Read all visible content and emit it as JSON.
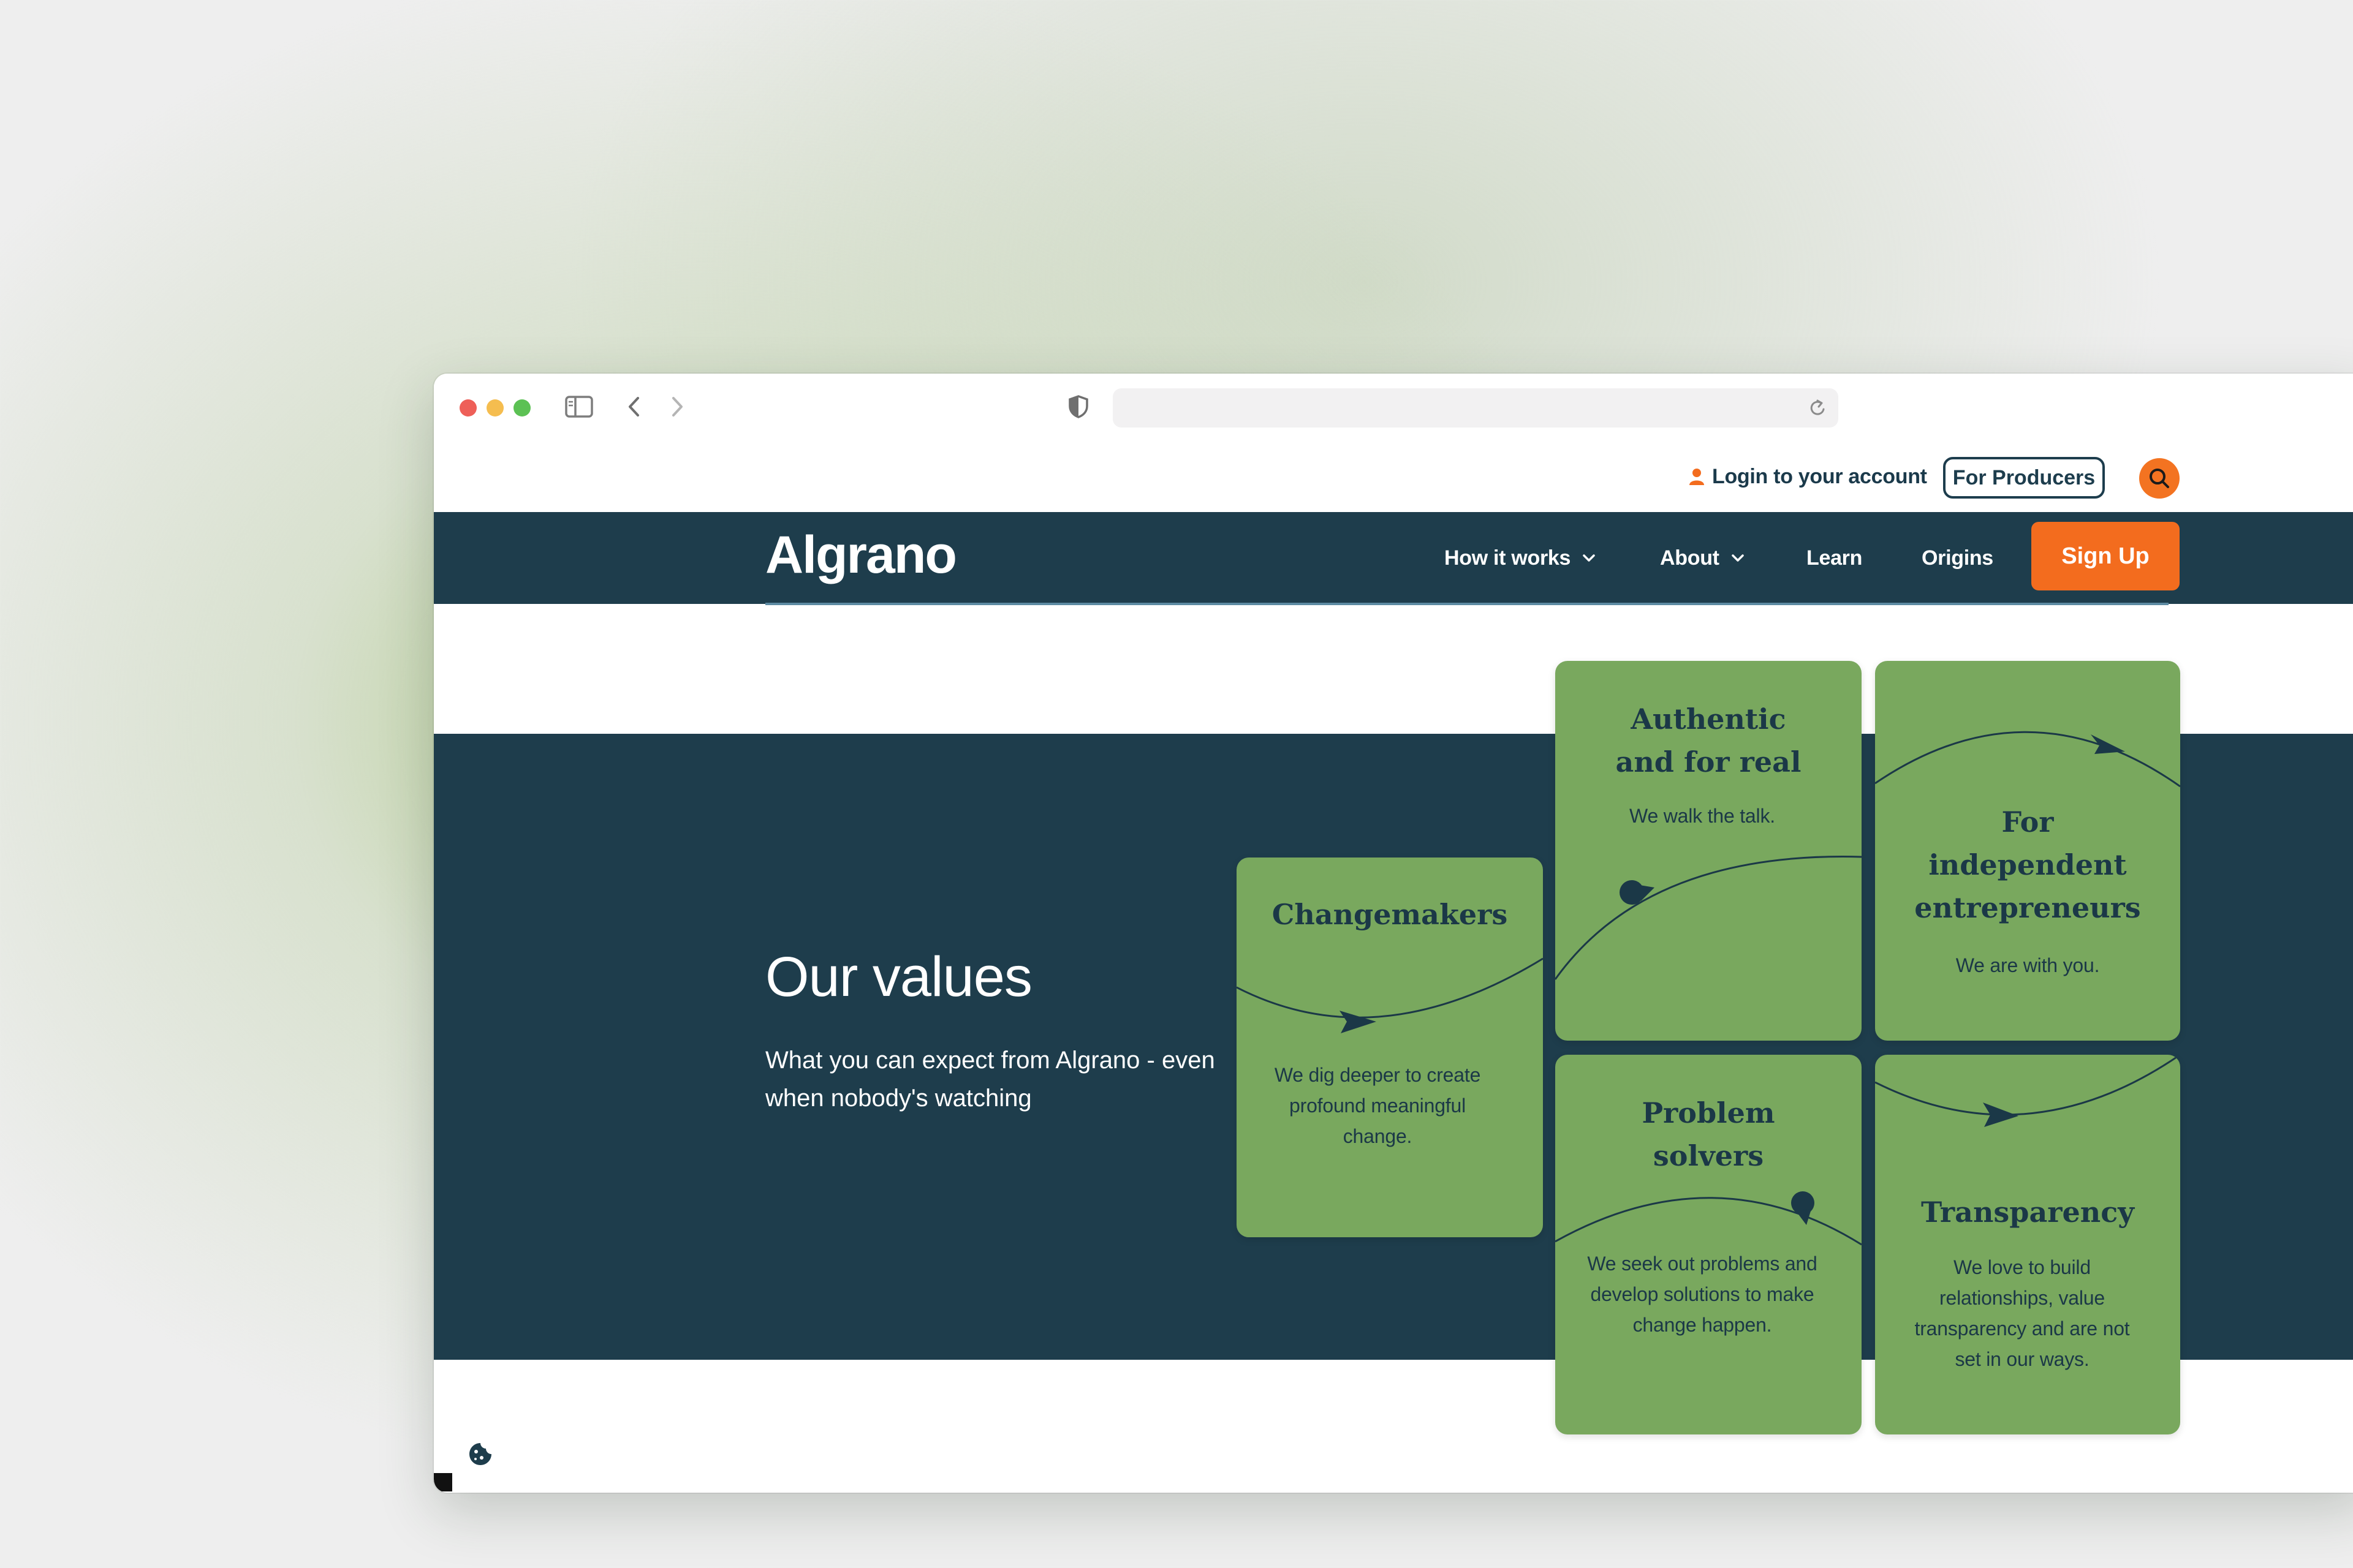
{
  "browser": {
    "address": ""
  },
  "utility_bar": {
    "login_label": "Login to your account",
    "producers_label": "For Producers"
  },
  "nav": {
    "logo": "Algrano",
    "items": [
      {
        "label": "How it works",
        "has_dropdown": true
      },
      {
        "label": "About",
        "has_dropdown": true
      },
      {
        "label": "Learn",
        "has_dropdown": false
      },
      {
        "label": "Origins",
        "has_dropdown": false
      }
    ],
    "signup_label": "Sign Up"
  },
  "values": {
    "title": "Our values",
    "subtitle": "What you can expect from Algrano - even when nobody's watching",
    "cards": [
      {
        "title": "Changemakers",
        "text": "We dig deeper to create profound meaningful change."
      },
      {
        "title": "Authentic and for real",
        "text": "We walk the talk."
      },
      {
        "title": "For independent entrepreneurs",
        "text": "We are with you."
      },
      {
        "title": "Problem solvers",
        "text": "We seek out problems and develop solutions to make change happen."
      },
      {
        "title": "Transparency",
        "text": "We love to build relationships, value transparency and are not set in our ways."
      }
    ]
  },
  "colors": {
    "navy": "#1e3d4c",
    "card_green": "#79a85e",
    "accent_orange": "#f36c1e"
  }
}
